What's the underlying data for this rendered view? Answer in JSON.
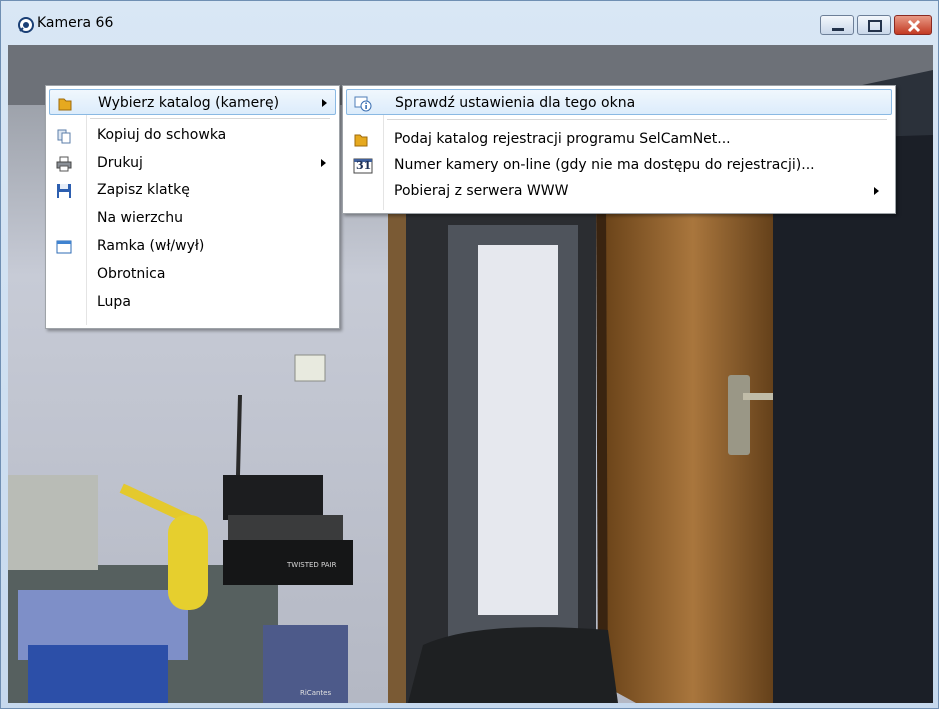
{
  "window": {
    "title": "Kamera 66",
    "icon": "camera-eye-icon",
    "buttons": [
      "minimize-icon",
      "maximize-icon",
      "close-icon"
    ]
  },
  "context_menu": {
    "items": [
      {
        "label": "Wybierz katalog (kamerę)",
        "icon": "folder-icon",
        "submenu": true,
        "highlighted": true
      },
      {
        "label": "Kopiuj do schowka",
        "icon": "copy-icon",
        "submenu": false
      },
      {
        "label": "Drukuj",
        "icon": "printer-icon",
        "submenu": true
      },
      {
        "label": "Zapisz klatkę",
        "icon": "floppy-disk-icon",
        "submenu": false
      },
      {
        "label": "Na wierzchu",
        "icon": "",
        "submenu": false
      },
      {
        "label": "Ramka (wł/wył)",
        "icon": "window-frame-icon",
        "submenu": false
      },
      {
        "label": "Obrotnica",
        "icon": "",
        "submenu": false
      },
      {
        "label": "Lupa",
        "icon": "",
        "submenu": false
      }
    ]
  },
  "submenu": {
    "items": [
      {
        "label": "Sprawdź ustawienia dla tego okna",
        "icon": "window-info-icon",
        "highlighted": true
      },
      {
        "label": "Podaj katalog rejestracji programu SelCamNet...",
        "icon": "folder-icon"
      },
      {
        "label": "Numer kamery on-line (gdy nie ma dostępu do rejestracji)...",
        "icon": "calendar-31-icon"
      },
      {
        "label": "Pobieraj z serwera WWW",
        "icon": "",
        "submenu": true
      }
    ],
    "calendar_icon_text": "31"
  },
  "camera_feed": {
    "devices_label": "TWISTED PAIR",
    "box_label": "RiCantes"
  },
  "colors": {
    "highlight_border": "#8ab9e3",
    "close_button": "#c33a23",
    "wall": "#c9ccd8",
    "door_wood": "#a0703a"
  }
}
